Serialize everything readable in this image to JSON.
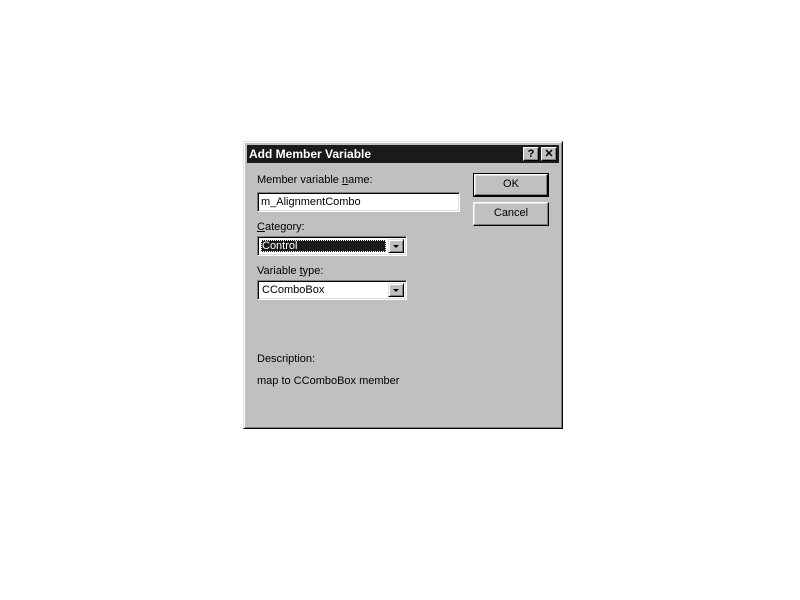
{
  "dialog": {
    "title": "Add Member Variable",
    "help_glyph": "?",
    "close_glyph": "✕"
  },
  "form": {
    "name_label_pre": "Member variable ",
    "name_label_u": "n",
    "name_label_post": "ame:",
    "name_value": "m_AlignmentCombo",
    "category_label_u": "C",
    "category_label_post": "ategory:",
    "category_value": "Control",
    "type_label_pre": "Variable ",
    "type_label_u": "t",
    "type_label_post": "ype:",
    "type_value": "CComboBox",
    "description_label": "Description:",
    "description_text": "map to CComboBox member"
  },
  "buttons": {
    "ok_label": "OK",
    "cancel_label": "Cancel"
  },
  "colors": {
    "face": "#c0c0c0",
    "titlebar": "#1a1a1a",
    "selection": "#1a1a1a"
  }
}
